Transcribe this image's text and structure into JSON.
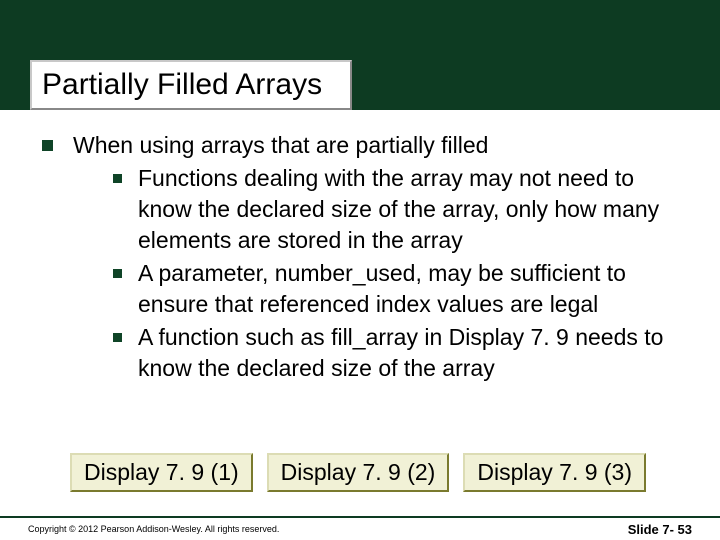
{
  "title": "Partially Filled Arrays",
  "main": {
    "intro": "When using arrays that are partially filled",
    "points": [
      "Functions dealing with the array may not need to know the declared size of the array, only how many elements are stored in the array",
      "A parameter, number_used,  may be sufficient to ensure that referenced index values are legal",
      "A function such as fill_array in Display 7. 9 needs to know the declared size of the array"
    ]
  },
  "buttons": {
    "d1": "Display 7. 9 (1)",
    "d2": "Display 7. 9 (2)",
    "d3": "Display 7. 9 (3)"
  },
  "footer": {
    "copyright": "Copyright © 2012 Pearson Addison-Wesley.  All rights reserved.",
    "slide": "Slide 7- 53"
  }
}
